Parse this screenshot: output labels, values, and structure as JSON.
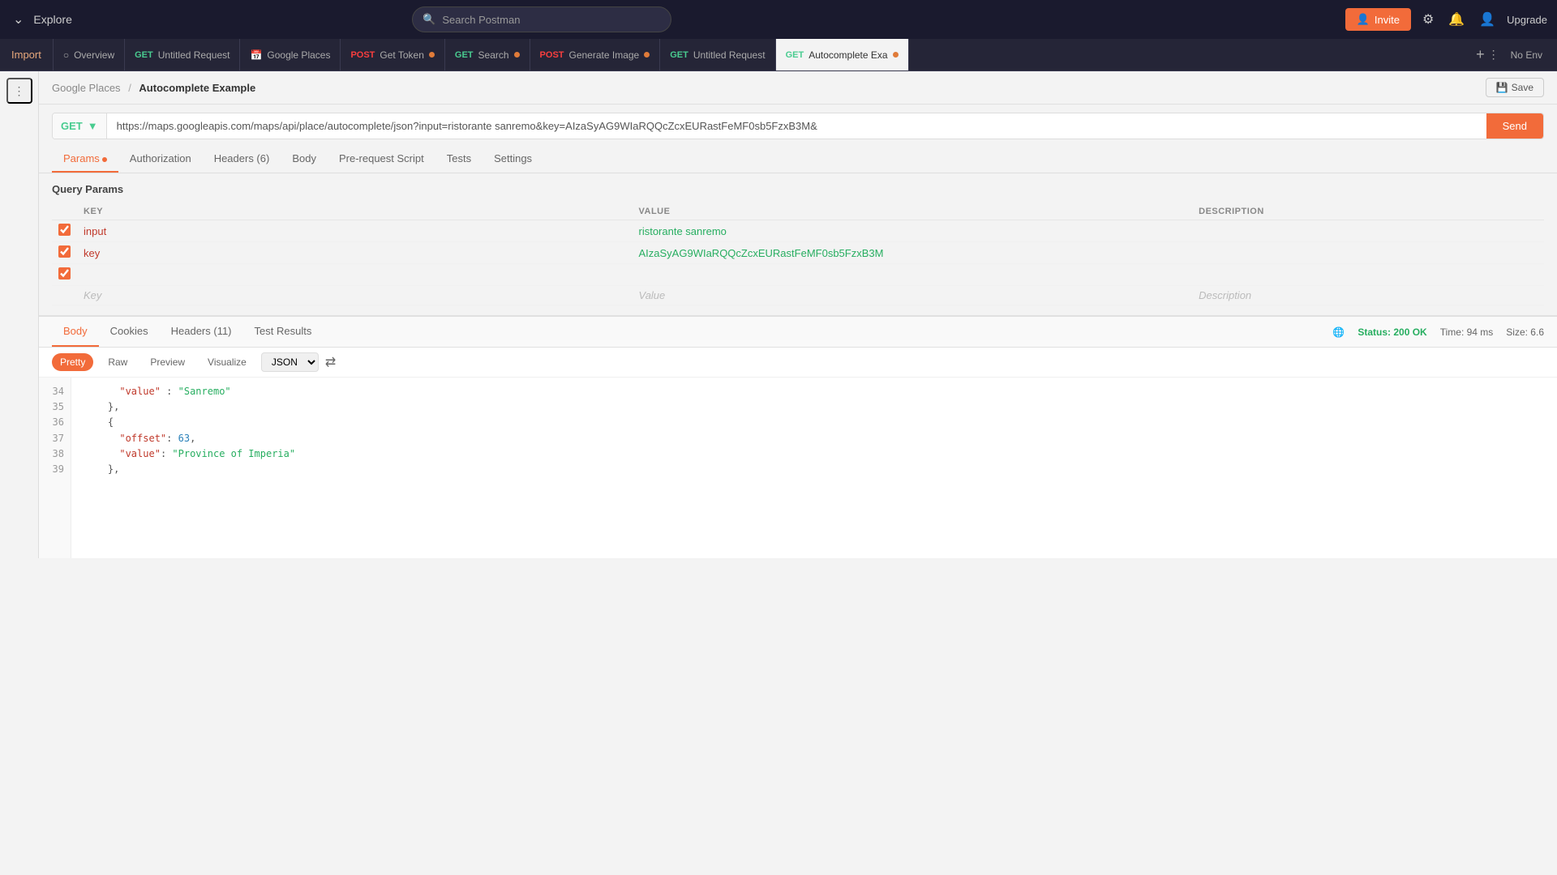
{
  "topbar": {
    "app_icon": "chevron-down",
    "explore_label": "Explore",
    "search_placeholder": "Search Postman",
    "invite_label": "Invite",
    "upgrade_label": "Upgrade"
  },
  "tabs": [
    {
      "id": "overview",
      "label": "Overview",
      "method": null,
      "dot": false,
      "active": false
    },
    {
      "id": "untitled-request-1",
      "label": "Untitled Request",
      "method": "GET",
      "dot": false,
      "active": false
    },
    {
      "id": "google-places",
      "label": "Google Places",
      "method": null,
      "dot": false,
      "active": false
    },
    {
      "id": "get-token",
      "label": "Get Token",
      "method": "POST",
      "dot": false,
      "active": false
    },
    {
      "id": "search",
      "label": "Search",
      "method": "GET",
      "dot": true,
      "active": false
    },
    {
      "id": "generate-image",
      "label": "Generate Image",
      "method": "POST",
      "dot": true,
      "active": false
    },
    {
      "id": "untitled-request-2",
      "label": "Untitled Request",
      "method": "GET",
      "dot": false,
      "active": false
    },
    {
      "id": "autocomplete-exa",
      "label": "Autocomplete Exa",
      "method": "GET",
      "dot": true,
      "active": true
    }
  ],
  "import_label": "Import",
  "no_env_label": "No Env",
  "breadcrumb": {
    "parent": "Google Places",
    "separator": "/",
    "current": "Autocomplete Example"
  },
  "save_label": "Save",
  "request": {
    "method": "GET",
    "url": "https://maps.googleapis.com/maps/api/place/autocomplete/json?input=ristorante sanremo&key=AIzaSyAG9WIaRQQcZcxEURastFeMF0sb5FzxB3M&",
    "tabs": [
      {
        "id": "params",
        "label": "Params",
        "dot": true,
        "active": true
      },
      {
        "id": "authorization",
        "label": "Authorization",
        "dot": false,
        "active": false
      },
      {
        "id": "headers",
        "label": "Headers (6)",
        "dot": false,
        "active": false
      },
      {
        "id": "body",
        "label": "Body",
        "dot": false,
        "active": false
      },
      {
        "id": "pre-request",
        "label": "Pre-request Script",
        "dot": false,
        "active": false
      },
      {
        "id": "tests",
        "label": "Tests",
        "dot": false,
        "active": false
      },
      {
        "id": "settings",
        "label": "Settings",
        "dot": false,
        "active": false
      }
    ],
    "query_params": {
      "title": "Query Params",
      "columns": [
        "KEY",
        "VALUE",
        "DESCRIPTION"
      ],
      "rows": [
        {
          "checked": true,
          "key": "input",
          "value": "ristorante sanremo",
          "description": ""
        },
        {
          "checked": true,
          "key": "key",
          "value": "AIzaSyAG9WIaRQQcZcxEURastFeMF0sb5FzxB3M",
          "description": ""
        },
        {
          "checked": true,
          "key": "",
          "value": "",
          "description": ""
        }
      ],
      "placeholder_key": "Key",
      "placeholder_value": "Value",
      "placeholder_description": "Description"
    }
  },
  "response": {
    "tabs": [
      {
        "id": "body",
        "label": "Body",
        "active": true
      },
      {
        "id": "cookies",
        "label": "Cookies",
        "active": false
      },
      {
        "id": "headers",
        "label": "Headers (11)",
        "active": false
      },
      {
        "id": "test-results",
        "label": "Test Results",
        "active": false
      }
    ],
    "status": "Status: 200 OK",
    "time": "Time: 94 ms",
    "size": "Size: 6.6",
    "format_buttons": [
      "Pretty",
      "Raw",
      "Preview",
      "Visualize"
    ],
    "active_format": "Pretty",
    "json_format": "JSON",
    "code_lines": [
      {
        "num": 34,
        "content": "      \"value\" : \"Sanremo\""
      },
      {
        "num": 35,
        "content": "    },"
      },
      {
        "num": 36,
        "content": "    {"
      },
      {
        "num": 37,
        "content": "      \"offset\": 63,"
      },
      {
        "num": 38,
        "content": "      \"value\": \"Province of Imperia\""
      },
      {
        "num": 39,
        "content": "    },"
      }
    ]
  }
}
